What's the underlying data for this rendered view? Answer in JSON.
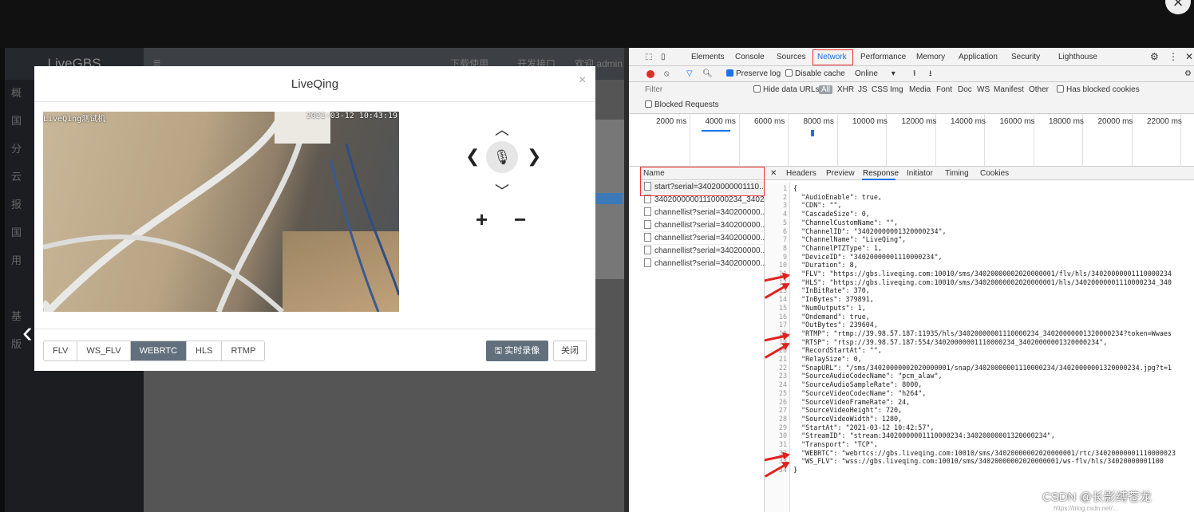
{
  "app": {
    "logo": "LiveGBS",
    "header_links": [
      "下载使用",
      "开发接口",
      "欢迎 admin"
    ],
    "sidebar_glyphs": [
      "概",
      "国",
      "分",
      "云",
      "报",
      "国",
      "用",
      "",
      "基",
      "版"
    ]
  },
  "modal": {
    "title": "LiveQing",
    "close_label": "×",
    "osd_left": "LiveQing测试机",
    "osd_right": "2021-03-12 10:43:19",
    "protocols": [
      "FLV",
      "WS_FLV",
      "WEBRTC",
      "HLS",
      "RTMP"
    ],
    "active_protocol": "WEBRTC",
    "record_label": "实时录像",
    "close_button": "关闭",
    "zoom_in": "+",
    "zoom_out": "−"
  },
  "devtools": {
    "tabs": [
      "Elements",
      "Console",
      "Sources",
      "Network",
      "Performance",
      "Memory",
      "Application",
      "Security",
      "Lighthouse"
    ],
    "active_tab": "Network",
    "toolbar": {
      "preserve_log": "Preserve log",
      "disable_cache": "Disable cache",
      "throttle": "Online"
    },
    "filter": {
      "placeholder": "Filter",
      "hide_data_urls": "Hide data URLs",
      "all": "All",
      "types": [
        "XHR",
        "JS",
        "CSS",
        "Img",
        "Media",
        "Font",
        "Doc",
        "WS",
        "Manifest",
        "Other"
      ],
      "blocked_cookies": "Has blocked cookies",
      "blocked_requests": "Blocked Requests"
    },
    "timeline_ticks": [
      "2000 ms",
      "4000 ms",
      "6000 ms",
      "8000 ms",
      "10000 ms",
      "12000 ms",
      "14000 ms",
      "16000 ms",
      "18000 ms",
      "20000 ms",
      "22000 ms",
      "2"
    ],
    "name_header": "Name",
    "requests": [
      "start?serial=34020000001110...",
      "34020000001110000234_3402...",
      "channellist?serial=340200000...",
      "channellist?serial=340200000...",
      "channellist?serial=340200000...",
      "channellist?serial=340200000...",
      "channellist?serial=340200000..."
    ],
    "detail_tabs": [
      "Headers",
      "Preview",
      "Response",
      "Initiator",
      "Timing",
      "Cookies"
    ],
    "active_detail_tab": "Response",
    "response_lines": [
      "{",
      "  \"AudioEnable\": true,",
      "  \"CDN\": \"\",",
      "  \"CascadeSize\": 0,",
      "  \"ChannelCustomName\": \"\",",
      "  \"ChannelID\": \"34020000001320000234\",",
      "  \"ChannelName\": \"LiveQing\",",
      "  \"ChannelPTZType\": 1,",
      "  \"DeviceID\": \"34020000001110000234\",",
      "  \"Duration\": 8,",
      "  \"FLV\": \"https://gbs.liveqing.com:10010/sms/34020000002020000001/flv/hls/34020000001110000234",
      "  \"HLS\": \"https://gbs.liveqing.com:10010/sms/34020000002020000001/hls/34020000001110000234_340",
      "  \"InBitRate\": 370,",
      "  \"InBytes\": 379891,",
      "  \"NumOutputs\": 1,",
      "  \"Ondemand\": true,",
      "  \"OutBytes\": 239604,",
      "  \"RTMP\": \"rtmp://39.98.57.187:11935/hls/34020000001110000234_34020000001320000234?token=Wwaes",
      "  \"RTSP\": \"rtsp://39.98.57.187:554/34020000001110000234_34020000001320000234\",",
      "  \"RecordStartAt\": \"\",",
      "  \"RelaySize\": 0,",
      "  \"SnapURL\": \"/sms/34020000002020000001/snap/34020000001110000234/34020000001320000234.jpg?t=1",
      "  \"SourceAudioCodecName\": \"pcm_alaw\",",
      "  \"SourceAudioSampleRate\": 8000,",
      "  \"SourceVideoCodecName\": \"h264\",",
      "  \"SourceVideoFrameRate\": 24,",
      "  \"SourceVideoHeight\": 720,",
      "  \"SourceVideoWidth\": 1280,",
      "  \"StartAt\": \"2021-03-12 10:42:57\",",
      "  \"StreamID\": \"stream:34020000001110000234:34020000001320000234\",",
      "  \"Transport\": \"TCP\",",
      "  \"WEBRTC\": \"webrtcs://gbs.liveqing.com:10010/sms/34020000002020000001/rtc/34020000001110000023",
      "  \"WS_FLV\": \"wss://gbs.liveqing.com:10010/sms/34020000002020000001/ws-flv/hls/34020000001100",
      "}"
    ]
  },
  "overlay": {
    "close": "×",
    "watermark": "CSDN @长影缚苍龙",
    "watermark_url": "https://blog.csdn.net/..."
  },
  "colors": {
    "accent": "#1a73e8",
    "highlight": "#e33333",
    "primary_btn": "#62707d"
  }
}
